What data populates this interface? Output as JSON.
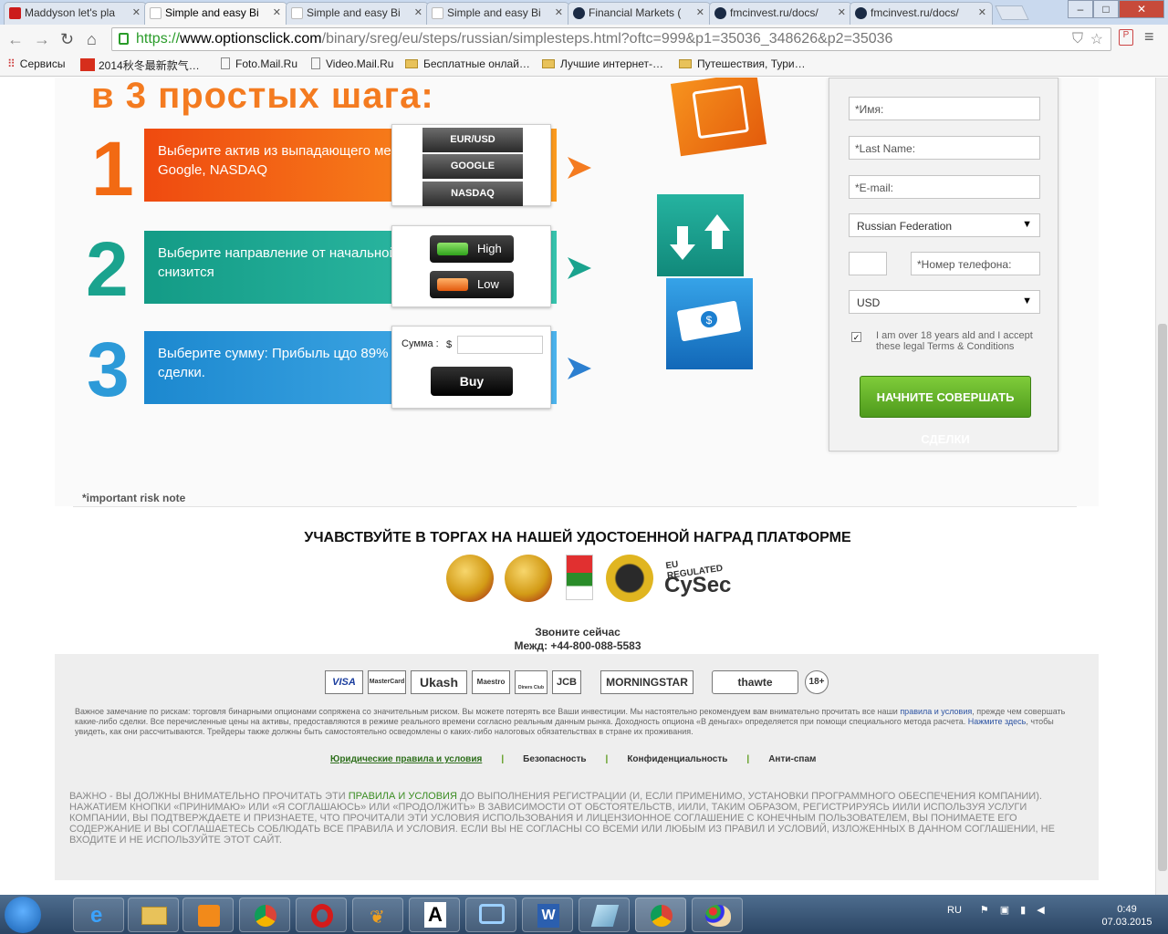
{
  "browser": {
    "tabs": [
      {
        "title": "Maddyson let's pla",
        "favicon": "youtube-icon",
        "color": "#cc1b1b"
      },
      {
        "title": "Simple and easy Bi",
        "favicon": "page-icon",
        "color": "#c7c7c7"
      },
      {
        "title": "Simple and easy Bi",
        "favicon": "page-icon",
        "color": "#c7c7c7"
      },
      {
        "title": "Simple and easy Bi",
        "favicon": "page-icon",
        "color": "#c7c7c7"
      },
      {
        "title": "Financial Markets (",
        "favicon": "circle-icon",
        "color": "#1a2a44"
      },
      {
        "title": "fmcinvest.ru/docs/",
        "favicon": "circle-icon",
        "color": "#1a2a44"
      },
      {
        "title": "fmcinvest.ru/docs/",
        "favicon": "circle-icon",
        "color": "#1a2a44"
      }
    ],
    "url_scheme": "https://",
    "url_host": "www.optionsclick.com",
    "url_path": "/binary/sreg/eu/steps/russian/simplesteps.html?oftc=999&p1=35036_348626&p2=35036",
    "bookmarks": [
      "Сервисы",
      "2014秋冬最新款气…",
      "Foto.Mail.Ru",
      "Video.Mail.Ru",
      "Бесплатные онлай…",
      "Лучшие интернет-…",
      "Путешествия, Тури…"
    ]
  },
  "hero": {
    "title": "в 3 простых шага:",
    "steps": [
      {
        "num": "1",
        "text": "Выберите актив из выпадающего меню, например: EUR/USD, Google, NASDAQ",
        "color": "#f26a13"
      },
      {
        "num": "2",
        "text": "Выберите направление от начальной точки: Возрастет или снизится",
        "color": "#1aa38e"
      },
      {
        "num": "3",
        "text": "Выберите сумму: Прибыль цдо 89% с каждой успешной сделки.",
        "color": "#2c9ad8"
      }
    ],
    "assets": [
      "EUR/USD",
      "GOOGLE",
      "NASDAQ"
    ],
    "high_label": "High",
    "low_label": "Low",
    "sum_label": "Сумма :",
    "currency": "$",
    "buy_label": "Buy"
  },
  "form": {
    "first_name_ph": "*Имя:",
    "last_name_ph": "*Last Name:",
    "email_ph": "*E-mail:",
    "country": "Russian Federation",
    "phone_ph": "*Номер телефона:",
    "currency": "USD",
    "terms": "I am over 18 years ald and I accept these legal Terms & Conditions",
    "submit": "НАЧНИТЕ СОВЕРШАТЬ СДЕЛКИ"
  },
  "risk_note": "*important risk note",
  "awards": {
    "title": "УЧАВСТВУЙТЕ В ТОРГАХ НА НАШЕЙ УДОСТОЕННОЙ НАГРАД ПЛАТФОРМЕ",
    "cysec_top": "EU REGULATED",
    "cysec": "CySec"
  },
  "contact": {
    "call": "Звоните сейчас",
    "phone": "Межд: +44-800-088-5583"
  },
  "payments": [
    "VISA",
    "MasterCard",
    "Ukash",
    "Maestro",
    "Diners Club",
    "JCB",
    "MORNINGSTAR",
    "thawte",
    "18+"
  ],
  "disclaimer": {
    "p1": "Важное замечание по рискам: торговля бинарными опционами сопряжена со значительным риском. Вы можете потерять все Ваши инвестиции. Мы настоятельно рекомендуем вам внимательно прочитать все наши ",
    "link1": "правила и условия",
    "p2": ", прежде чем совершать какие-либо сделки. Все перечисленные цены на активы, предоставляются в режиме реального времени согласно реальным данным рынка. Доходность опциона «В деньгах» определяется при помощи специального метода расчета. ",
    "link2": "Нажмите здесь",
    "p3": ", чтобы увидеть, как они рассчитываются. Трейдеры также должны быть самостоятельно осведомлены о каких-либо налоговых обязательствах в стране их проживания."
  },
  "legal_nav": [
    "Юридические правила и условия",
    "Безопасность",
    "Конфиденциальность",
    "Анти-спам"
  ],
  "important": {
    "p1": "ВАЖНО - ВЫ ДОЛЖНЫ ВНИМАТЕЛЬНО ПРОЧИТАТЬ ЭТИ ",
    "link": "ПРАВИЛА И УСЛОВИЯ",
    "p2": " ДО ВЫПОЛНЕНИЯ РЕГИСТРАЦИИ (И, ЕСЛИ ПРИМЕНИМО, УСТАНОВКИ ПРОГРАММНОГО ОБЕСПЕЧЕНИЯ КОМПАНИИ). НАЖАТИЕМ КНОПКИ «ПРИНИМАЮ» ИЛИ «Я СОГЛАШАЮСЬ» ИЛИ «ПРОДОЛЖИТЬ» В ЗАВИСИМОСТИ ОТ ОБСТОЯТЕЛЬСТВ, ИИЛИ, ТАКИМ ОБРАЗОМ, РЕГИСТРИРУЯСЬ ИИЛИ ИСПОЛЬЗУЯ УСЛУГИ КОМПАНИИ, ВЫ ПОДТВЕРЖДАЕТЕ И ПРИЗНАЕТЕ, ЧТО ПРОЧИТАЛИ ЭТИ УСЛОВИЯ ИСПОЛЬЗОВАНИЯ И ЛИЦЕНЗИОННОЕ СОГЛАШЕНИЕ С КОНЕЧНЫМ ПОЛЬЗОВАТЕЛЕМ, ВЫ ПОНИМАЕТЕ ЕГО СОДЕРЖАНИЕ И ВЫ СОГЛАШАЕТЕСЬ СОБЛЮДАТЬ ВСЕ ПРАВИЛА И УСЛОВИЯ. ЕСЛИ ВЫ НЕ СОГЛАСНЫ СО ВСЕМИ ИЛИ ЛЮБЫМ ИЗ ПРАВИЛ И УСЛОВИЙ, ИЗЛОЖЕННЫХ В ДАННОМ СОГЛАШЕНИИ, НЕ ВХОДИТЕ И НЕ ИСПОЛЬЗУЙТЕ ЭТОТ САЙТ."
  },
  "taskbar": {
    "lang": "RU",
    "time": "0:49",
    "date": "07.03.2015",
    "apps": [
      "ie-icon",
      "explorer-icon",
      "media-player-icon",
      "chrome-icon",
      "opera-icon",
      "butterfly-icon",
      "font-icon",
      "network-icon",
      "word-icon",
      "notepad-icon",
      "chrome-icon",
      "paint-icon"
    ]
  }
}
